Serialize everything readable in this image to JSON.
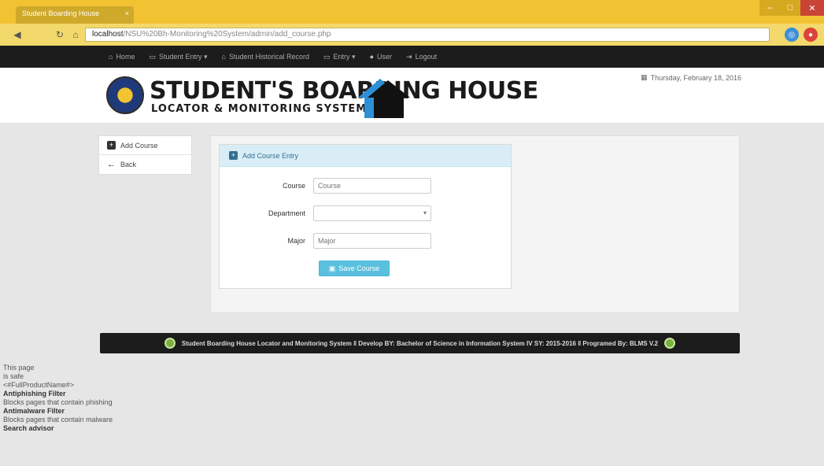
{
  "browser": {
    "tab_title": "Student Boarding House",
    "tab_close": "×",
    "url_host": "localhost",
    "url_path": "/NSU%20Bh-Monitoring%20System/admin/add_course.php"
  },
  "nav": {
    "items": [
      {
        "icon": "home-icon",
        "label": "Home"
      },
      {
        "icon": "folder-icon",
        "label": "Student Entry ▾"
      },
      {
        "icon": "home-icon",
        "label": "Student Historical Record"
      },
      {
        "icon": "folder-icon",
        "label": "Entry ▾"
      },
      {
        "icon": "user-icon",
        "label": "User"
      },
      {
        "icon": "logout-icon",
        "label": "Logout"
      }
    ]
  },
  "header": {
    "title": "STUDENT'S BOARDING HOUSE",
    "subtitle": "LOCATOR & MONITORING SYSTEM",
    "date": "Thursday, February 18, 2016"
  },
  "sidebar": {
    "items": [
      {
        "label": "Add Course"
      },
      {
        "label": "Back"
      }
    ]
  },
  "form": {
    "panel_title": "Add Course Entry",
    "course_label": "Course",
    "course_placeholder": "Course",
    "department_label": "Department",
    "major_label": "Major",
    "major_placeholder": "Major",
    "save_label": "Save Course"
  },
  "footer": {
    "text": "Student Boarding House Locator and Monitoring System  ‖  Develop BY: Bachelor of Science in Information System IV SY: 2015-2016  ‖  Programed By: BLMS V.2"
  },
  "extension": {
    "line1": "This page",
    "line2": "is safe",
    "line3": "<#FullProductName#>",
    "antiphishing_title": "Antiphishing Filter",
    "antiphishing_desc": "Blocks pages that contain phishing",
    "antimalware_title": "Antimalware Filter",
    "antimalware_desc": "Blocks pages that contain malware",
    "search_advisor": "Search advisor"
  },
  "colors": {
    "chrome": "#f1c232",
    "navbar": "#1c1c1c",
    "panel_head": "#d9edf7",
    "save_button": "#5bc0de"
  }
}
